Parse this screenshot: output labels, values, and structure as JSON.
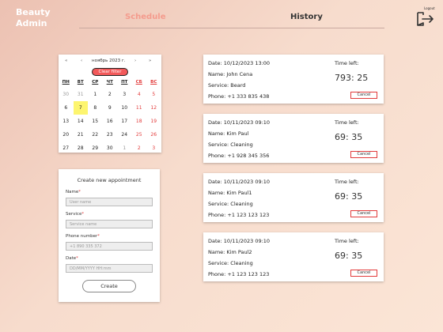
{
  "brand": {
    "line1": "Beauty",
    "line2": "Admin"
  },
  "nav": {
    "schedule": "Schedule",
    "history": "History",
    "active": "schedule"
  },
  "logout": {
    "label": "Logout"
  },
  "calendar": {
    "prev_year": "«",
    "prev_month": "‹",
    "title": "ноябрь 2023 г.",
    "next_month": "›",
    "next_year": "»",
    "clear_filter": "Clear filter",
    "weekdays": [
      "ПН",
      "ВТ",
      "СР",
      "ЧТ",
      "ПТ",
      "СБ",
      "ВС"
    ],
    "weeks": [
      [
        "30",
        "31",
        "1",
        "2",
        "3",
        "4",
        "5"
      ],
      [
        "6",
        "7",
        "8",
        "9",
        "10",
        "11",
        "12"
      ],
      [
        "13",
        "14",
        "15",
        "16",
        "17",
        "18",
        "19"
      ],
      [
        "20",
        "21",
        "22",
        "23",
        "24",
        "25",
        "26"
      ],
      [
        "27",
        "28",
        "29",
        "30",
        "1",
        "2",
        "3"
      ]
    ],
    "today": "7",
    "colors": {
      "weekend": "#e23b3b",
      "today_bg": "#fdf56f",
      "clear_bg": "#f2595a"
    }
  },
  "form": {
    "title": "Create new appointment",
    "fields": [
      {
        "label": "Name",
        "placeholder": "User name",
        "required": "*"
      },
      {
        "label": "Service",
        "placeholder": "Service name",
        "required": "*"
      },
      {
        "label": "Phone number",
        "placeholder": "+1 890 335 372",
        "required": "*"
      },
      {
        "label": "Date",
        "placeholder": "DD/MM/YYYY HH:mm",
        "required": "*"
      }
    ],
    "submit": "Create"
  },
  "appointments": [
    {
      "date": "Date: 10/12/2023 13:00",
      "name": "Name: John Cena",
      "service": "Service: Beard",
      "phone": "Phone: +1 333 835 438",
      "time_left_label": "Time left:",
      "time_left": "793: 25",
      "cancel": "Cancel"
    },
    {
      "date": "Date: 10/11/2023 09:10",
      "name": "Name: Kim Paul",
      "service": "Service: Cleaning",
      "phone": "Phone: +1 928 345 356",
      "time_left_label": "Time left:",
      "time_left": "69: 35",
      "cancel": "Cancel"
    },
    {
      "date": "Date: 10/11/2023 09:10",
      "name": "Name: Kim Paul1",
      "service": "Service: Cleaning",
      "phone": "Phone: +1 123 123 123",
      "time_left_label": "Time left:",
      "time_left": "69: 35",
      "cancel": "Cancel"
    },
    {
      "date": "Date: 10/11/2023 09:10",
      "name": "Name: Kim Paul2",
      "service": "Service: Cleaning",
      "phone": "Phone: +1 123 123 123",
      "time_left_label": "Time left:",
      "time_left": "69: 35",
      "cancel": "Cancel"
    }
  ]
}
